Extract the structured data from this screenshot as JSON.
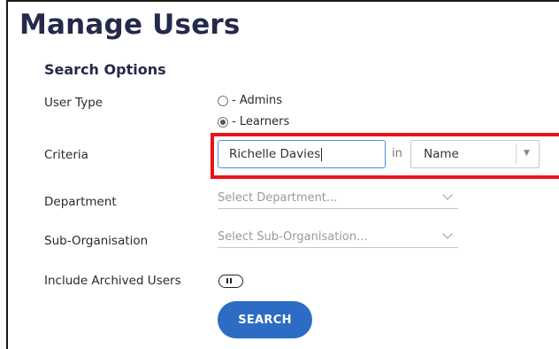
{
  "page": {
    "title": "Manage Users",
    "section_title": "Search Options"
  },
  "user_type": {
    "label": "User Type",
    "options": [
      {
        "label": "- Admins",
        "checked": false
      },
      {
        "label": "- Learners",
        "checked": true
      }
    ]
  },
  "criteria": {
    "label": "Criteria",
    "value": "Richelle Davies",
    "in_label": "in",
    "field_selected": "Name"
  },
  "department": {
    "label": "Department",
    "placeholder": "Select Department..."
  },
  "sub_organisation": {
    "label": "Sub-Organisation",
    "placeholder": "Select Sub-Organisation..."
  },
  "include_archived": {
    "label": "Include Archived Users",
    "enabled": false
  },
  "search_button": {
    "label": "SEARCH"
  },
  "colors": {
    "title": "#232a4a",
    "highlight": "#e8141c",
    "button": "#2c6cc4",
    "input_focus_border": "#4a8fdc"
  }
}
